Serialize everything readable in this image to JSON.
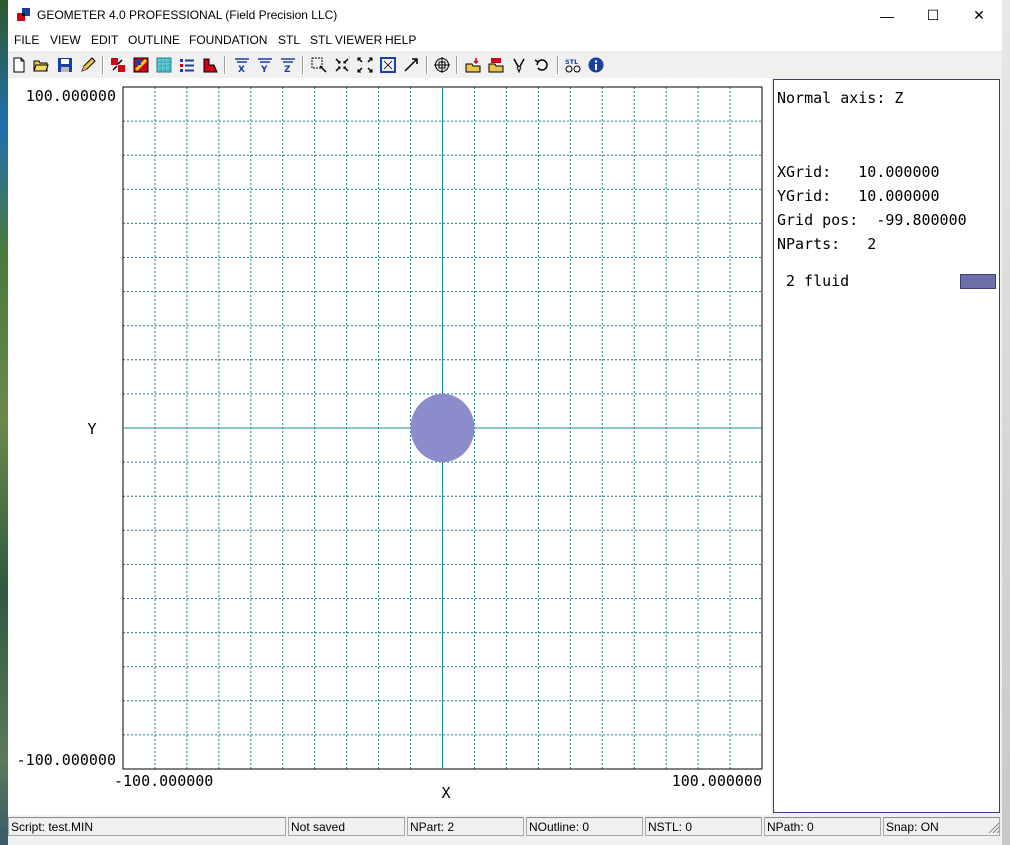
{
  "window": {
    "title": "GEOMETER 4.0 PROFESSIONAL (Field Precision LLC)",
    "controls": {
      "minimize": "—",
      "maximize": "☐",
      "close": "✕"
    }
  },
  "menu": [
    "FILE",
    "VIEW",
    "EDIT",
    "OUTLINE",
    "FOUNDATION",
    "STL",
    "STL VIEWER",
    "HELP"
  ],
  "toolbar": {
    "icons": [
      "new-file-icon",
      "open-folder-icon",
      "save-icon",
      "pencil-icon",
      "parts-icon",
      "edit-region-icon",
      "grid-icon",
      "list-icon",
      "shape-icon",
      "filter-x-icon",
      "filter-y-icon",
      "filter-z-icon",
      "zoom-window-icon",
      "zoom-in-icon",
      "zoom-out-icon",
      "zoom-fit-icon",
      "pan-icon",
      "crosshair-icon",
      "import-icon",
      "export-icon",
      "tools-icon",
      "undo-icon",
      "stl-icon",
      "info-icon"
    ],
    "stl_label": "STL"
  },
  "plot": {
    "x_axis_label": "X",
    "y_axis_label": "Y",
    "x_min_label": "-100.000000",
    "x_max_label": "100.000000",
    "y_min_label": "-100.000000",
    "y_max_label": "100.000000",
    "x_range": [
      -100,
      100
    ],
    "y_range": [
      -100,
      100
    ],
    "grid_step": 10,
    "grid": true,
    "grid_color": "#1e7f8c",
    "axis_color": "#1e8a94",
    "part": {
      "shape": "circle",
      "cx": 0,
      "cy": 0,
      "r": 10,
      "color": "#8c8ccc"
    }
  },
  "info": {
    "normal_axis": "Normal axis: Z",
    "xgrid": "XGrid:   10.000000",
    "ygrid": "YGrid:   10.000000",
    "grid_pos": "Grid pos:  -99.800000",
    "nparts": "NParts:   2",
    "part_entry": "2 fluid",
    "part_color": "#6e6ea8"
  },
  "status": {
    "script": "Script: test.MIN",
    "saved": "Not saved",
    "npart": "NPart:   2",
    "noutline": "NOutline:  0",
    "nstl": "NSTL:   0",
    "npath": "NPath:   0",
    "snap": "Snap: ON"
  }
}
